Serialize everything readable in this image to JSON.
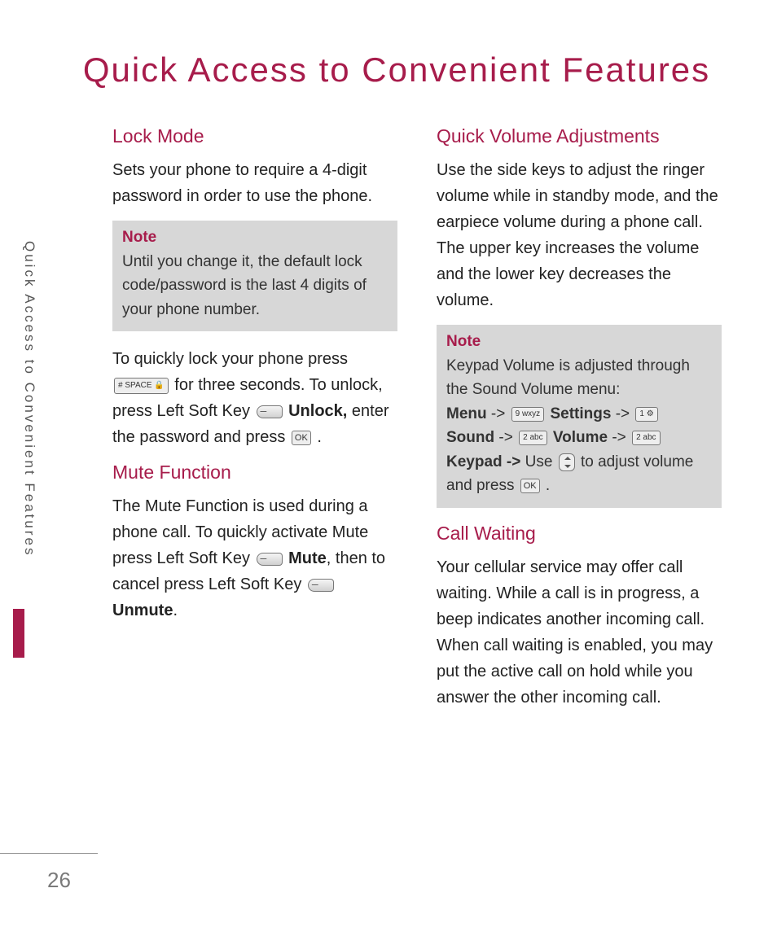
{
  "page": {
    "title": "Quick Access to Convenient Features",
    "sideLabel": "Quick Access to Convenient Features",
    "number": "26"
  },
  "left": {
    "lock": {
      "head": "Lock Mode",
      "intro": "Sets your phone to require a 4-digit password in order to use the phone.",
      "note": {
        "head": "Note",
        "body": "Until you change it, the default lock code/password is the last 4 digits of your phone number."
      },
      "p2a": "To quickly lock your phone press",
      "hashKey": "# SPACE 🔒",
      "p2b": "for three seconds. To unlock, press Left Soft Key",
      "unlockBold": "Unlock,",
      "p2c": "enter the password and press",
      "okKey": "OK",
      "period": "."
    },
    "mute": {
      "head": "Mute Function",
      "p1a": "The Mute Function is used during a phone call. To quickly activate Mute press Left Soft Key",
      "muteBold": "Mute",
      "comma": ", then to cancel press Left Soft Key",
      "unmuteBold": "Unmute",
      "period": "."
    }
  },
  "right": {
    "vol": {
      "head": "Quick Volume Adjustments",
      "intro": "Use the side keys to adjust the ringer volume while in standby mode, and the earpiece volume during a phone call. The upper key increases the volume and the lower key decreases the volume.",
      "note": {
        "head": "Note",
        "line1": "Keypad Volume is adjusted through the Sound Volume menu:",
        "menu": "Menu",
        "arrow": "->",
        "k9": "9 wxyz",
        "settings": "Settings",
        "k1": "1 ⚙",
        "sound": "Sound",
        "k2a": "2 abc",
        "volume": "Volume",
        "k2b": "2 abc",
        "keypad": "Keypad ->",
        "use": "Use",
        "adjust": "to adjust volume and press",
        "ok": "OK",
        "period": "."
      }
    },
    "cw": {
      "head": "Call Waiting",
      "body": "Your cellular service may offer call waiting. While a call is in progress, a beep indicates another incoming call. When call waiting is enabled, you may put the active call on hold while you answer the other incoming call."
    }
  }
}
